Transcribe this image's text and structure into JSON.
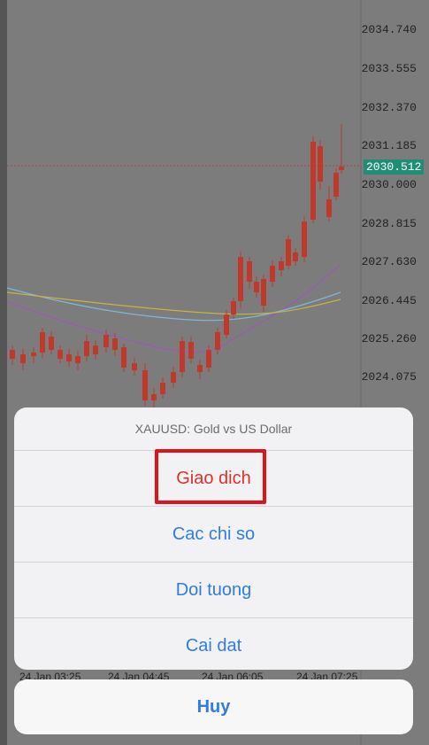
{
  "chart": {
    "current_price": "2030.512",
    "price_levels": [
      "2034.740",
      "2033.555",
      "2032.370",
      "2031.185",
      "2030.000",
      "2028.815",
      "2027.630",
      "2026.445",
      "2025.260",
      "2024.075"
    ],
    "time_labels": [
      "24 Jan 03:25",
      "24 Jan 04:45",
      "24 Jan 06:05",
      "24 Jan 07:25"
    ],
    "colors": {
      "up": "#1e8f72",
      "down": "#c0392b",
      "ma_fast": "#9b59b6",
      "ma_mid": "#7fb8d6",
      "ma_slow": "#c8b43c"
    }
  },
  "action_sheet": {
    "title": "XAUUSD: Gold vs US Dollar",
    "items": [
      {
        "label": "Giao dich"
      },
      {
        "label": "Cac chi so"
      },
      {
        "label": "Doi tuong"
      },
      {
        "label": "Cai dat"
      }
    ],
    "cancel_label": "Huy"
  }
}
